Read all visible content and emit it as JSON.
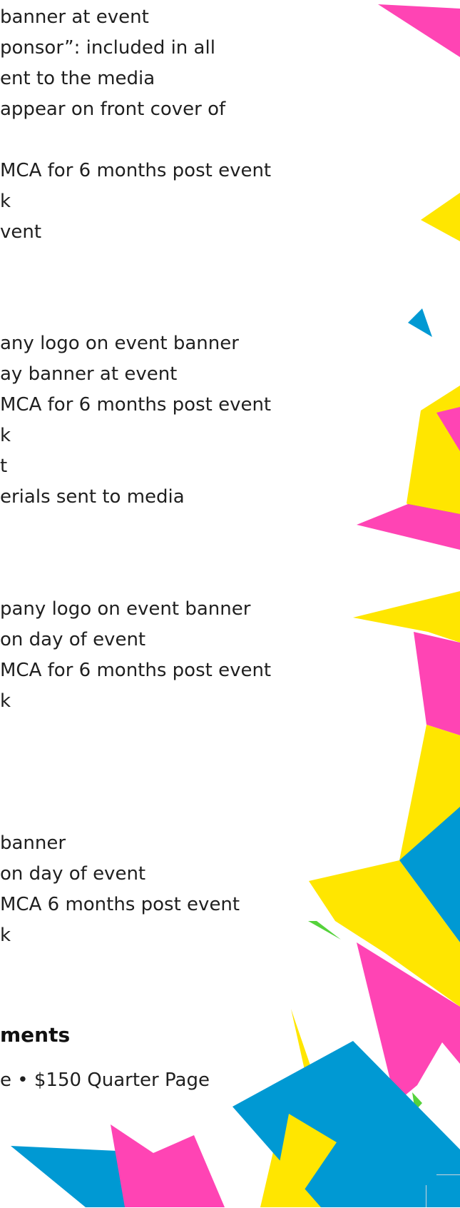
{
  "sections": [
    {
      "lines": [
        "banner at event",
        "ponsor”: included in all",
        "ent to the media",
        "appear on front cover of",
        "",
        "MCA for 6 months post event",
        "k",
        "vent"
      ]
    },
    {
      "lines": [
        "any logo on event banner",
        "ay banner at event",
        "MCA for 6 months post event",
        "k",
        "t",
        "erials sent to media"
      ]
    },
    {
      "lines": [
        "pany logo on event banner",
        " on day of event",
        "MCA for 6 months post event",
        "k"
      ]
    },
    {
      "lines": [
        "banner",
        "on day of event",
        "MCA 6 months post event",
        "k"
      ]
    }
  ],
  "advertisements": {
    "heading": "ments",
    "line": "e • $150 Quarter Page"
  },
  "colors": {
    "pink": "#ff44b4",
    "yellow": "#ffe600",
    "blue": "#0099d3",
    "green": "#55d23b"
  }
}
